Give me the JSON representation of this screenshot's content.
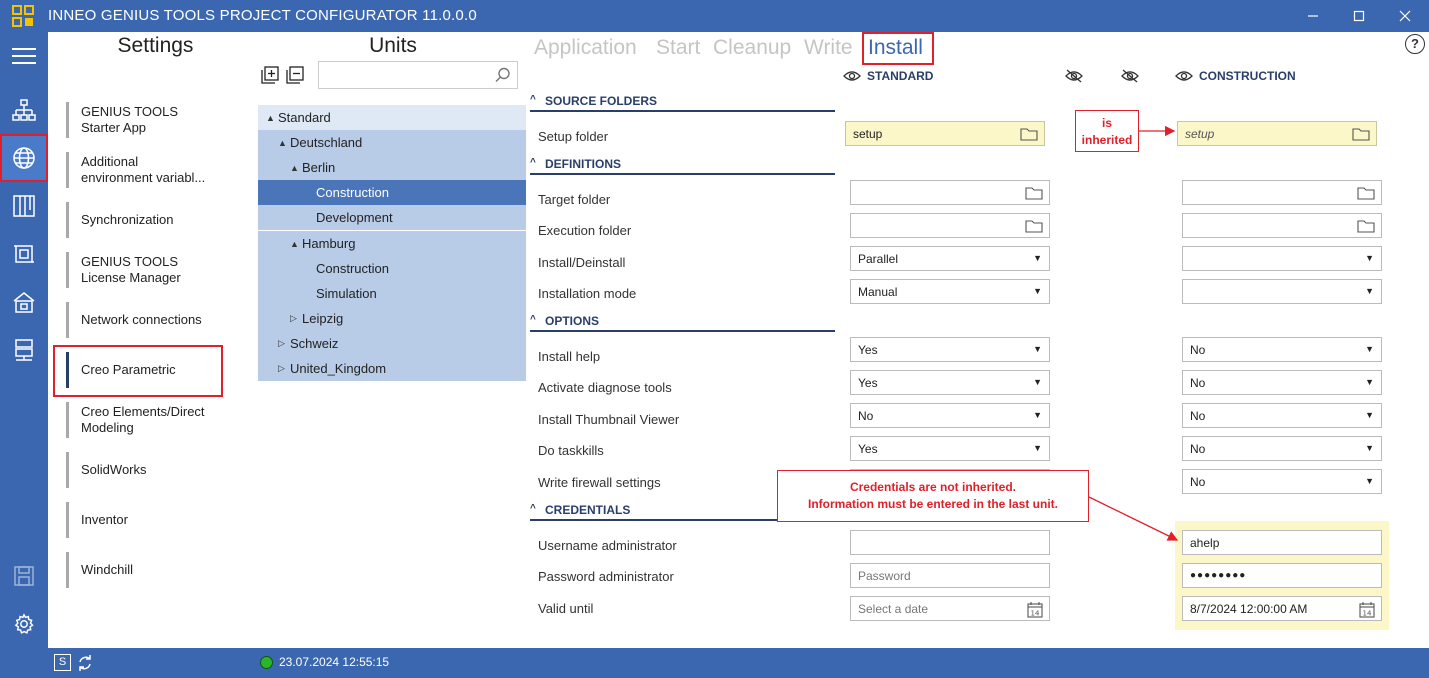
{
  "app": {
    "title": "INNEO GENIUS TOOLS PROJECT CONFIGURATOR 11.0.0.0"
  },
  "settings": {
    "title": "Settings",
    "items": [
      {
        "label": "GENIUS TOOLS\nStarter App"
      },
      {
        "label": "Additional\nenvironment variabl..."
      },
      {
        "label": "Synchronization"
      },
      {
        "label": "GENIUS TOOLS\nLicense Manager"
      },
      {
        "label": "Network connections"
      },
      {
        "label": "Creo Parametric"
      },
      {
        "label": "Creo Elements/Direct\nModeling"
      },
      {
        "label": "SolidWorks"
      },
      {
        "label": "Inventor"
      },
      {
        "label": "Windchill"
      }
    ]
  },
  "units": {
    "title": "Units",
    "search_value": "",
    "tree": [
      {
        "label": "Standard",
        "toggle": "▲"
      },
      {
        "label": "Deutschland",
        "toggle": "▲"
      },
      {
        "label": "Berlin",
        "toggle": "▲"
      },
      {
        "label": "Construction",
        "toggle": ""
      },
      {
        "label": "Development",
        "toggle": ""
      },
      {
        "label": "Hamburg",
        "toggle": "▲"
      },
      {
        "label": "Construction",
        "toggle": ""
      },
      {
        "label": "Simulation",
        "toggle": ""
      },
      {
        "label": "Leipzig",
        "toggle": "▷"
      },
      {
        "label": "Schweiz",
        "toggle": "▷"
      },
      {
        "label": "United_Kingdom",
        "toggle": "▷"
      }
    ]
  },
  "tabs": [
    {
      "label": "Application"
    },
    {
      "label": "Start"
    },
    {
      "label": "Cleanup"
    },
    {
      "label": "Write"
    },
    {
      "label": "Install"
    }
  ],
  "help_label": "?",
  "columns": {
    "standard": "STANDARD",
    "construction": "CONSTRUCTION"
  },
  "sections": {
    "source_folders": "SOURCE FOLDERS",
    "definitions": "DEFINITIONS",
    "options": "OPTIONS",
    "credentials": "CREDENTIALS"
  },
  "fields": {
    "setup_folder": {
      "label": "Setup folder",
      "standard": "setup",
      "construction": "setup"
    },
    "target_folder": {
      "label": "Target folder",
      "standard": "",
      "construction": ""
    },
    "execution_folder": {
      "label": "Execution folder",
      "standard": "",
      "construction": ""
    },
    "install_deinstall": {
      "label": "Install/Deinstall",
      "standard": "Parallel",
      "construction": ""
    },
    "installation_mode": {
      "label": "Installation mode",
      "standard": "Manual",
      "construction": ""
    },
    "install_help": {
      "label": "Install help",
      "standard": "Yes",
      "construction": "No"
    },
    "activate_diagnose": {
      "label": "Activate diagnose tools",
      "standard": "Yes",
      "construction": "No"
    },
    "install_thumbnail": {
      "label": "Install Thumbnail Viewer",
      "standard": "No",
      "construction": "No"
    },
    "do_taskkills": {
      "label": "Do taskkills",
      "standard": "Yes",
      "construction": "No"
    },
    "write_firewall": {
      "label": "Write firewall settings",
      "standard": "",
      "construction": "No"
    },
    "username_admin": {
      "label": "Username administrator",
      "standard": "",
      "construction": "ahelp"
    },
    "password_admin": {
      "label": "Password administrator",
      "standard_placeholder": "Password",
      "construction": "●●●●●●●●"
    },
    "valid_until": {
      "label": "Valid until",
      "standard_placeholder": "Select a date",
      "construction": "8/7/2024 12:00:00 AM"
    }
  },
  "callouts": {
    "inherited": "is\ninherited",
    "credentials": "Credentials are not inherited.\nInformation must be entered in the last unit."
  },
  "status": {
    "s_label": "S",
    "timestamp": "23.07.2024 12:55:15"
  },
  "colors": {
    "accent": "#3b67b0",
    "highlight": "#e0202a",
    "inherited_bg": "#fbf7c8",
    "tree_selected": "#4a75b8",
    "status_ok": "#2bb52b"
  }
}
